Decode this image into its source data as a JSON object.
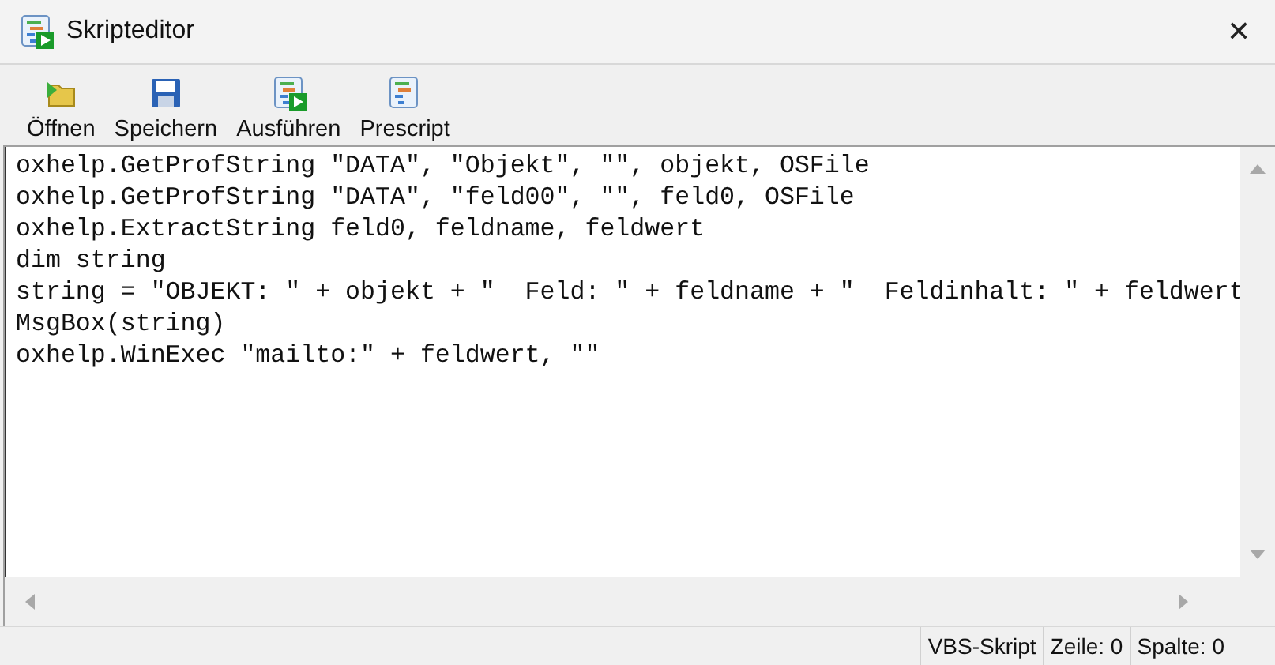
{
  "window": {
    "title": "Skripteditor",
    "close": "✕"
  },
  "toolbar": [
    {
      "kind": "open",
      "label": "Öffnen"
    },
    {
      "kind": "save",
      "label": "Speichern"
    },
    {
      "kind": "run",
      "label": "Ausführen"
    },
    {
      "kind": "script",
      "label": "Prescript"
    }
  ],
  "editor": {
    "lines": [
      "oxhelp.GetProfString \"DATA\", \"Objekt\", \"\", objekt, OSFile",
      "oxhelp.GetProfString \"DATA\", \"feld00\", \"\", feld0, OSFile",
      "oxhelp.ExtractString feld0, feldname, feldwert",
      "dim string",
      "string = \"OBJEKT: \" + objekt + \"  Feld: \" + feldname + \"  Feldinhalt: \" + feldwert",
      "MsgBox(string)",
      "oxhelp.WinExec \"mailto:\" + feldwert, \"\""
    ]
  },
  "status_bar": [
    "VBS-Skript",
    "Zeile: 0",
    "Spalte: 0"
  ]
}
